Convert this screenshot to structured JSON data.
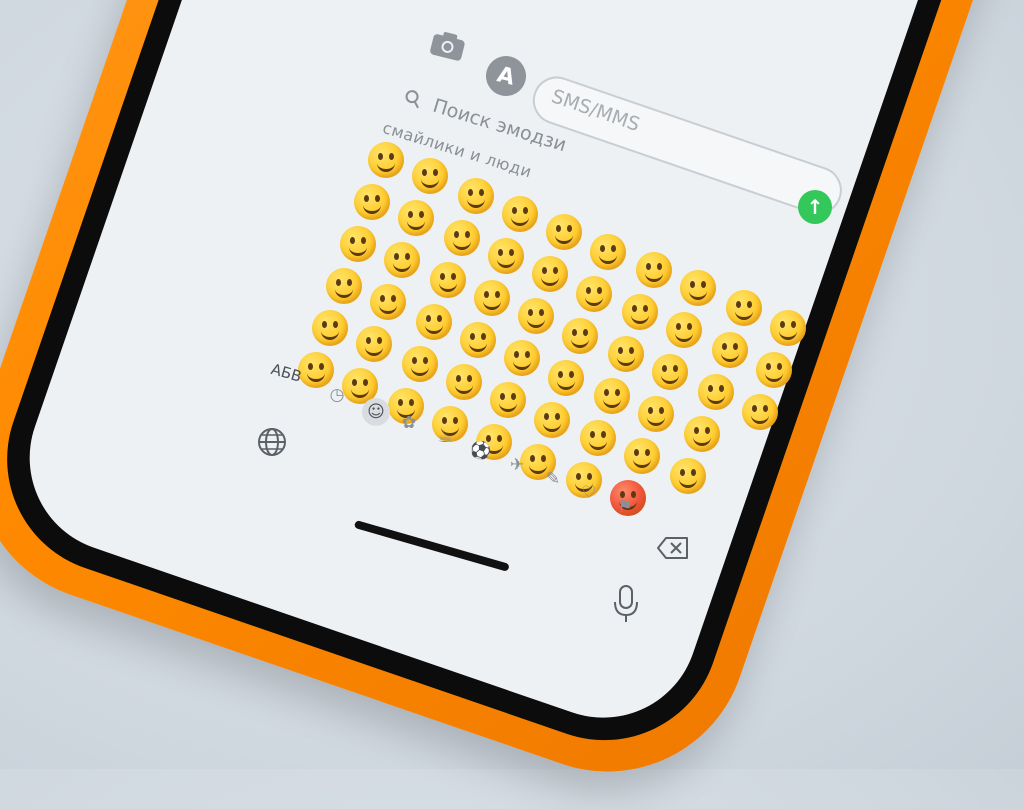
{
  "search": {
    "placeholder": "Поиск эмодзи"
  },
  "category": {
    "title": "смайлики и люди"
  },
  "message_field": {
    "placeholder": "SMS/MMS"
  },
  "keyboard": {
    "abc_label": "АБВ"
  },
  "icons": {
    "camera": "camera-icon",
    "app_store": "app-store-icon",
    "search": "search-icon",
    "send": "send-arrow-icon",
    "globe": "globe-icon",
    "delete": "delete-icon",
    "microphone": "microphone-icon",
    "categories": [
      "recent-icon",
      "smileys-icon",
      "animals-icon",
      "food-icon",
      "activity-icon",
      "travel-icon",
      "objects-icon",
      "symbols-icon",
      "flags-icon"
    ]
  },
  "colors": {
    "case": "#ff8a00",
    "send_button": "#34c759",
    "screen": "#eef1f4"
  }
}
